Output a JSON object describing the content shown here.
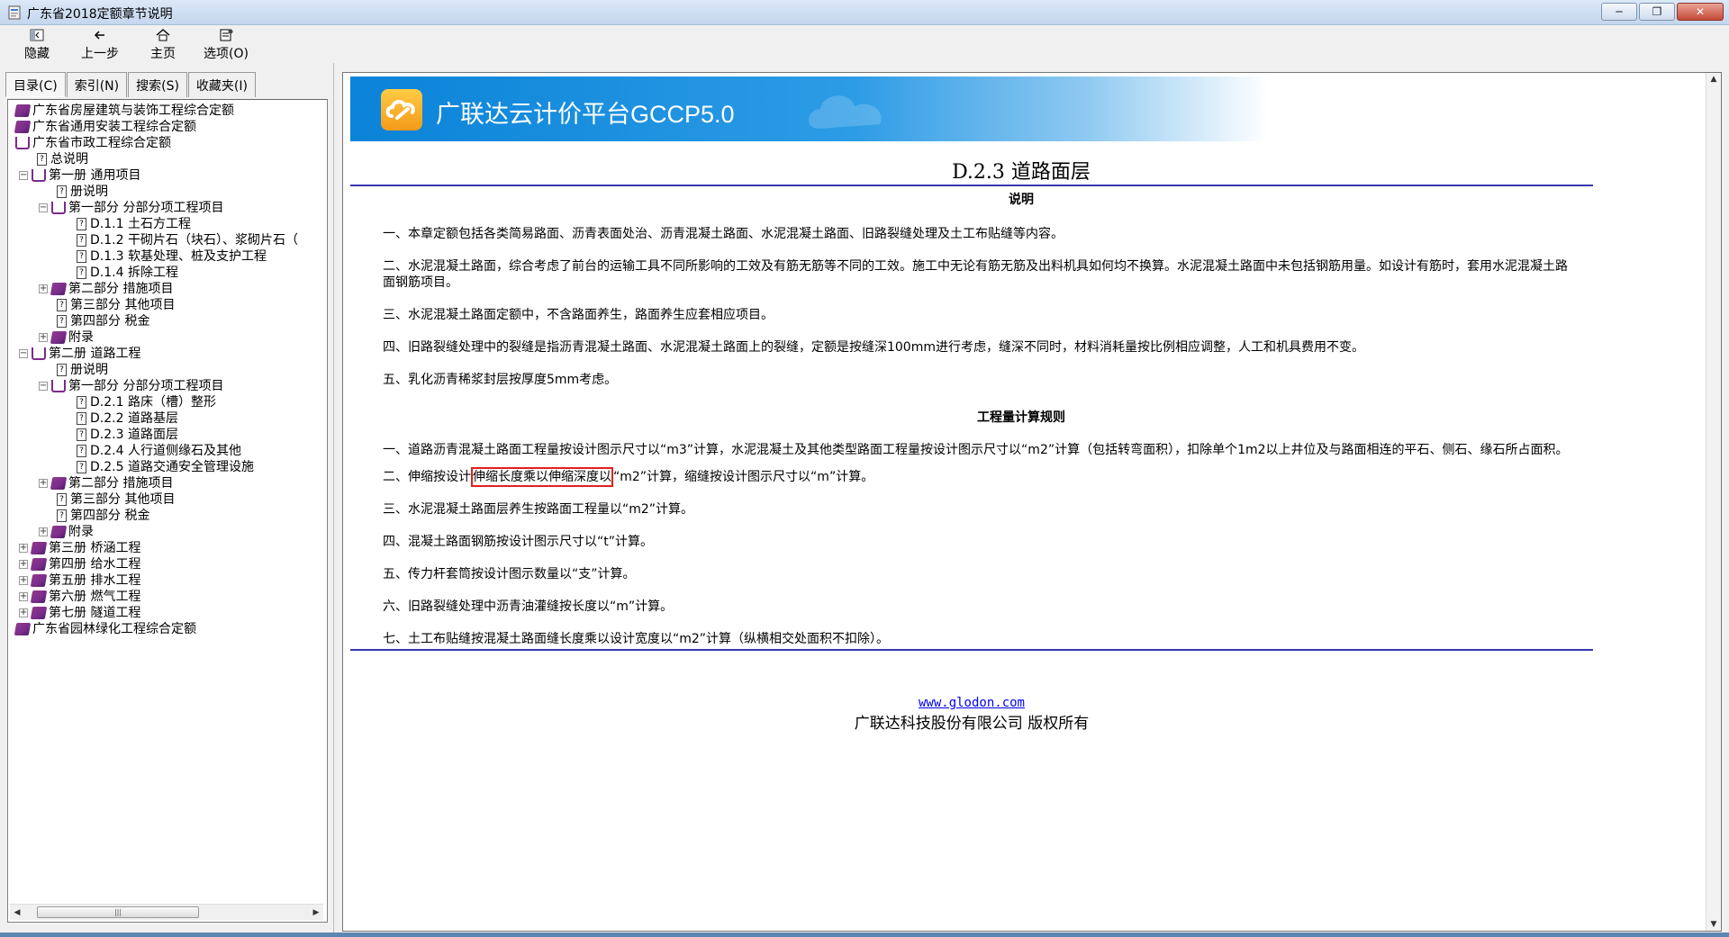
{
  "window": {
    "title": "广东省2018定额章节说明"
  },
  "toolbar": {
    "hide_label": "隐藏",
    "back_label": "上一步",
    "home_label": "主页",
    "options_label": "选项(O)"
  },
  "tabs": [
    {
      "label": "目录(C)"
    },
    {
      "label": "索引(N)"
    },
    {
      "label": "搜索(S)"
    },
    {
      "label": "收藏夹(I)"
    }
  ],
  "tree": [
    {
      "label": "广东省房屋建筑与装饰工程综合定额"
    },
    {
      "label": "广东省通用安装工程综合定额"
    },
    {
      "label": "广东省市政工程综合定额"
    },
    {
      "label": "总说明"
    },
    {
      "label": "第一册 通用项目"
    },
    {
      "label": "册说明"
    },
    {
      "label": "第一部分 分部分项工程项目"
    },
    {
      "label": "D.1.1 土石方工程"
    },
    {
      "label": "D.1.2 干砌片石（块石）、浆砌片石（"
    },
    {
      "label": "D.1.3 软基处理、桩及支护工程"
    },
    {
      "label": "D.1.4 拆除工程"
    },
    {
      "label": "第二部分 措施项目"
    },
    {
      "label": "第三部分 其他项目"
    },
    {
      "label": "第四部分 税金"
    },
    {
      "label": "附录"
    },
    {
      "label": "第二册 道路工程"
    },
    {
      "label": "册说明"
    },
    {
      "label": "第一部分 分部分项工程项目"
    },
    {
      "label": "D.2.1 路床（槽）整形"
    },
    {
      "label": "D.2.2 道路基层"
    },
    {
      "label": "D.2.3 道路面层"
    },
    {
      "label": "D.2.4 人行道侧缘石及其他"
    },
    {
      "label": "D.2.5 道路交通安全管理设施"
    },
    {
      "label": "第二部分 措施项目"
    },
    {
      "label": "第三部分 其他项目"
    },
    {
      "label": "第四部分 税金"
    },
    {
      "label": "附录"
    },
    {
      "label": "第三册 桥涵工程"
    },
    {
      "label": "第四册 给水工程"
    },
    {
      "label": "第五册 排水工程"
    },
    {
      "label": "第六册 燃气工程"
    },
    {
      "label": "第七册 隧道工程"
    },
    {
      "label": "广东省园林绿化工程综合定额"
    }
  ],
  "banner": {
    "title": "广联达云计价平台GCCP5.0"
  },
  "doc": {
    "title": "D.2.3 道路面层",
    "section1": "说明",
    "notes": [
      "一、本章定额包括各类简易路面、沥青表面处治、沥青混凝土路面、水泥混凝土路面、旧路裂缝处理及土工布贴缝等内容。",
      "二、水泥混凝土路面，综合考虑了前台的运输工具不同所影响的工效及有筋无筋等不同的工效。施工中无论有筋无筋及出料机具如何均不换算。水泥混凝土路面中未包括钢筋用量。如设计有筋时，套用水泥混凝土路面钢筋项目。",
      "三、水泥混凝土路面定额中，不含路面养生，路面养生应套相应项目。",
      "四、旧路裂缝处理中的裂缝是指沥青混凝土路面、水泥混凝土路面上的裂缝，定额是按缝深100mm进行考虑，缝深不同时，材料消耗量按比例相应调整，人工和机具费用不变。",
      "五、乳化沥青稀浆封层按厚度5mm考虑。"
    ],
    "section2": "工程量计算规则",
    "rule1": "一、道路沥青混凝土路面工程量按设计图示尺寸以“m3”计算，水泥混凝土及其他类型路面工程量按设计图示尺寸以“m2”计算（包括转弯面积），扣除单个1m2以上井位及与路面相连的平石、侧石、缘石所占面积。",
    "rule2_prefix": "二、伸缩按设计",
    "rule2_highlight": "伸缩长度乘以伸缩深度以",
    "rule2_suffix": "“m2”计算，缩缝按设计图示尺寸以“m”计算。",
    "rules": [
      "三、水泥混凝土路面层养生按路面工程量以“m2”计算。",
      "四、混凝土路面钢筋按设计图示尺寸以“t”计算。",
      "五、传力杆套筒按设计图示数量以“支”计算。",
      "六、旧路裂缝处理中沥青油灌缝按长度以“m”计算。",
      "七、土工布贴缝按混凝土路面缝长度乘以设计宽度以“m2”计算（纵横相交处面积不扣除）。"
    ]
  },
  "footer": {
    "link": "www.glodon.com",
    "copyright": "广联达科技股份有限公司 版权所有"
  }
}
